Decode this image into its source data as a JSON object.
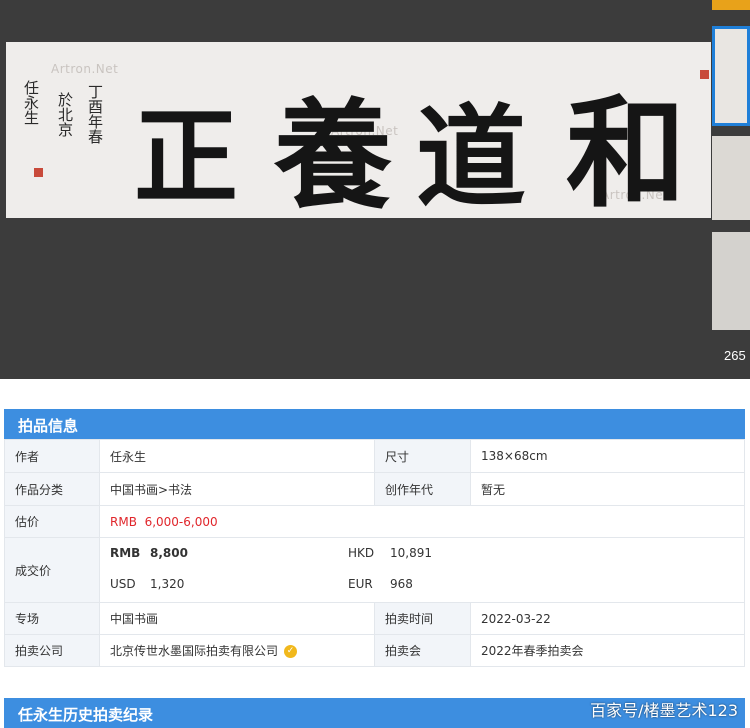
{
  "viewer": {
    "watermark": "Artron.Net",
    "artwork_chars": [
      "正",
      "養",
      "道",
      "和"
    ],
    "inscription": [
      "丁酉年春",
      "於北京",
      "任永生"
    ],
    "thumb_count": "265"
  },
  "info": {
    "title": "拍品信息",
    "author_label": "作者",
    "author": "任永生",
    "size_label": "尺寸",
    "size": "138×68cm",
    "category_label": "作品分类",
    "category": "中国书画>书法",
    "year_label": "创作年代",
    "year": "暂无",
    "estimate_label": "估价",
    "estimate_currency": "RMB",
    "estimate": "6,000-6,000",
    "deal_label": "成交价",
    "deal": {
      "rmb_label": "RMB",
      "rmb": "8,800",
      "hkd_label": "HKD",
      "hkd": "10,891",
      "usd_label": "USD",
      "usd": "1,320",
      "eur_label": "EUR",
      "eur": "968"
    },
    "session_label": "专场",
    "session": "中国书画",
    "date_label": "拍卖时间",
    "date": "2022-03-22",
    "company_label": "拍卖公司",
    "company": "北京传世水墨国际拍卖有限公司",
    "sale_label": "拍卖会",
    "sale": "2022年春季拍卖会"
  },
  "history": {
    "title": "任永生历史拍卖纪录"
  },
  "credit": "百家号/楮墨艺术123",
  "colors": {
    "header_blue": "#3d8ee0",
    "label_bg": "#f2f5f9",
    "estimate_red": "#e0262b",
    "viewer_bg": "#3c3c3c",
    "thumb_active": "#1f7fd8"
  }
}
